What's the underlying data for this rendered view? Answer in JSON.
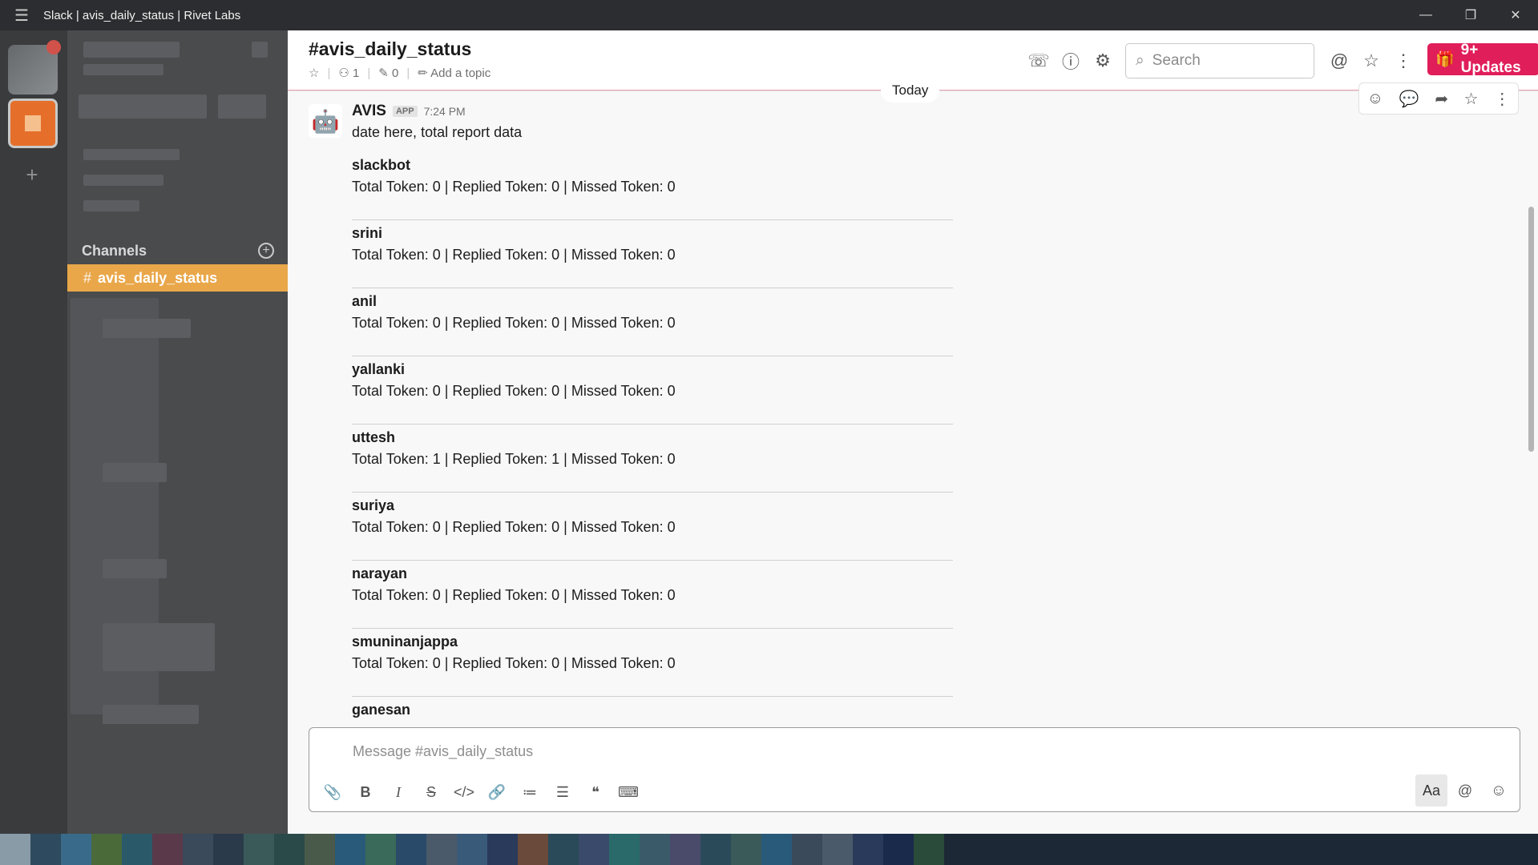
{
  "titlebar": {
    "title": "Slack | avis_daily_status | Rivet Labs",
    "menu_icon": "hamburger-icon"
  },
  "sidebar": {
    "channels_label": "Channels",
    "active_channel": "avis_daily_status"
  },
  "header": {
    "channel_name": "#avis_daily_status",
    "members": "1",
    "pins": "0",
    "add_topic": "Add a topic",
    "search_placeholder": "Search",
    "updates_label": "9+ Updates"
  },
  "messages": {
    "day_divider": "Today",
    "sender": "AVIS",
    "app_badge": "APP",
    "time": "7:24 PM",
    "intro": "date here, total report data",
    "report": [
      {
        "user": "slackbot",
        "stats": "Total Token: 0 | Replied Token: 0 | Missed Token: 0"
      },
      {
        "user": "srini",
        "stats": "Total Token: 0 | Replied Token: 0 | Missed Token: 0"
      },
      {
        "user": "anil",
        "stats": "Total Token: 0 | Replied Token: 0 | Missed Token: 0"
      },
      {
        "user": "yallanki",
        "stats": "Total Token: 0 | Replied Token: 0 | Missed Token: 0"
      },
      {
        "user": "uttesh",
        "stats": "Total Token: 1 | Replied Token: 1 | Missed Token: 0"
      },
      {
        "user": "suriya",
        "stats": "Total Token: 0 | Replied Token: 0 | Missed Token: 0"
      },
      {
        "user": "narayan",
        "stats": "Total Token: 0 | Replied Token: 0 | Missed Token: 0"
      },
      {
        "user": "smuninanjappa",
        "stats": "Total Token: 0 | Replied Token: 0 | Missed Token: 0"
      },
      {
        "user": "ganesan",
        "stats": ""
      }
    ]
  },
  "composer": {
    "placeholder": "Message #avis_daily_status",
    "format_toggle": "Aa"
  },
  "colors": {
    "active_channel": "#e9a74a",
    "updates_button": "#e01e5a",
    "sidebar_bg": "#4a4b4d",
    "rail_bg": "#3a3b3d"
  }
}
